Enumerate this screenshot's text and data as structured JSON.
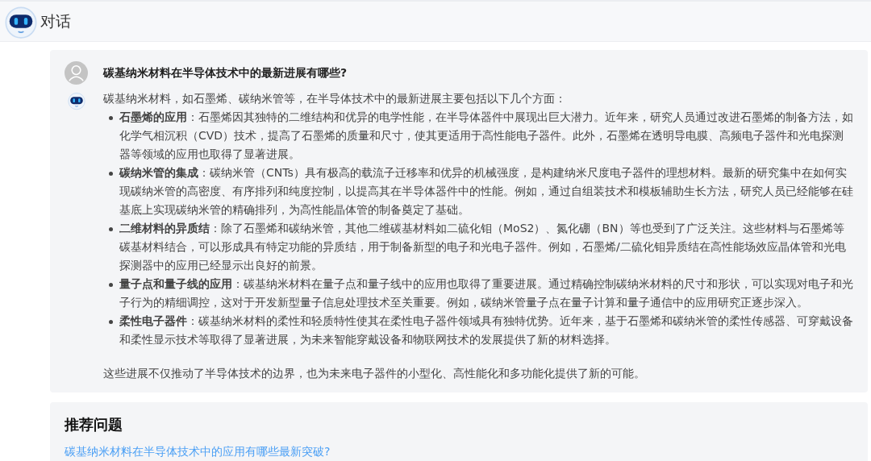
{
  "header": {
    "title": "对话"
  },
  "conversation": {
    "question": "碳基纳米材料在半导体技术中的最新进展有哪些?",
    "answer": {
      "intro": "碳基纳米材料，如石墨烯、碳纳米管等，在半导体技术中的最新进展主要包括以下几个方面：",
      "points": [
        "**石墨烯的应用**：石墨烯因其独特的二维结构和优异的电学性能，在半导体器件中展现出巨大潜力。近年来，研究人员通过改进石墨烯的制备方法，如化学气相沉积（CVD）技术，提高了石墨烯的质量和尺寸，使其更适用于高性能电子器件。此外，石墨烯在透明导电膜、高频电子器件和光电探测器等领域的应用也取得了显著进展。",
        "**碳纳米管的集成**：碳纳米管（CNTs）具有极高的载流子迁移率和优异的机械强度，是构建纳米尺度电子器件的理想材料。最新的研究集中在如何实现碳纳米管的高密度、有序排列和纯度控制，以提高其在半导体器件中的性能。例如，通过自组装技术和模板辅助生长方法，研究人员已经能够在硅基底上实现碳纳米管的精确排列，为高性能晶体管的制备奠定了基础。",
        "**二维材料的异质结**：除了石墨烯和碳纳米管，其他二维碳基材料如二硫化钼（MoS2）、氮化硼（BN）等也受到了广泛关注。这些材料与石墨烯等碳基材料结合，可以形成具有特定功能的异质结，用于制备新型的电子和光电子器件。例如，石墨烯/二硫化钼异质结在高性能场效应晶体管和光电探测器中的应用已经显示出良好的前景。",
        "**量子点和量子线的应用**：碳基纳米材料在量子点和量子线中的应用也取得了重要进展。通过精确控制碳纳米材料的尺寸和形状，可以实现对电子和光子行为的精细调控，这对于开发新型量子信息处理技术至关重要。例如，碳纳米管量子点在量子计算和量子通信中的应用研究正逐步深入。",
        "**柔性电子器件**：碳基纳米材料的柔性和轻质特性使其在柔性电子器件领域具有独特优势。近年来，基于石墨烯和碳纳米管的柔性传感器、可穿戴设备和柔性显示技术等取得了显著进展，为未来智能穿戴设备和物联网技术的发展提供了新的材料选择。"
      ],
      "conclusion": "这些进展不仅推动了半导体技术的边界，也为未来电子器件的小型化、高性能化和多功能化提供了新的可能。"
    }
  },
  "recommended": {
    "title": "推荐问题",
    "questions": [
      "碳基纳米材料在半导体技术中的应用有哪些最新突破?"
    ]
  }
}
